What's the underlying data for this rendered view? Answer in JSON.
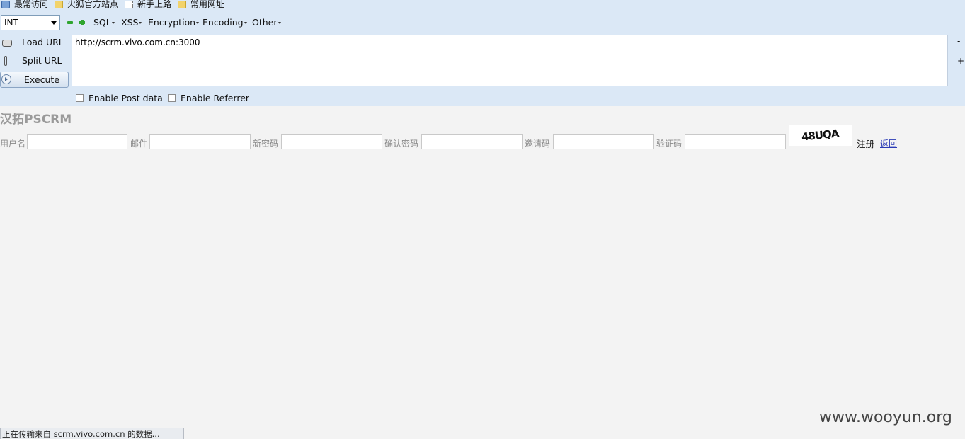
{
  "bookmarks": [
    {
      "label": "最常访问",
      "icon": "recent-icon"
    },
    {
      "label": "火狐官方站点",
      "icon": "folder-icon"
    },
    {
      "label": "新手上路",
      "icon": "page-icon"
    },
    {
      "label": "常用网址",
      "icon": "folder-icon"
    }
  ],
  "hackbar": {
    "select_value": "INT",
    "menus": [
      "SQL",
      "XSS",
      "Encryption",
      "Encoding",
      "Other"
    ],
    "load_url": "Load URL",
    "split_url": "Split URL",
    "execute": "Execute",
    "url_value": "http://scrm.vivo.com.cn:3000",
    "side_minus": "-",
    "side_plus": "+",
    "enable_post": "Enable Post data",
    "enable_referrer": "Enable Referrer"
  },
  "page": {
    "title": "汉拓PSCRM",
    "fields": {
      "username": "用户名",
      "email": "邮件",
      "new_password": "新密码",
      "confirm_password": "确认密码",
      "invite_code": "邀请码",
      "captcha": "验证码"
    },
    "captcha_text": "48UQA",
    "register": "注册",
    "back": "返回"
  },
  "watermark": "www.wooyun.org",
  "status": "正在传输来自 scrm.vivo.com.cn 的数据..."
}
